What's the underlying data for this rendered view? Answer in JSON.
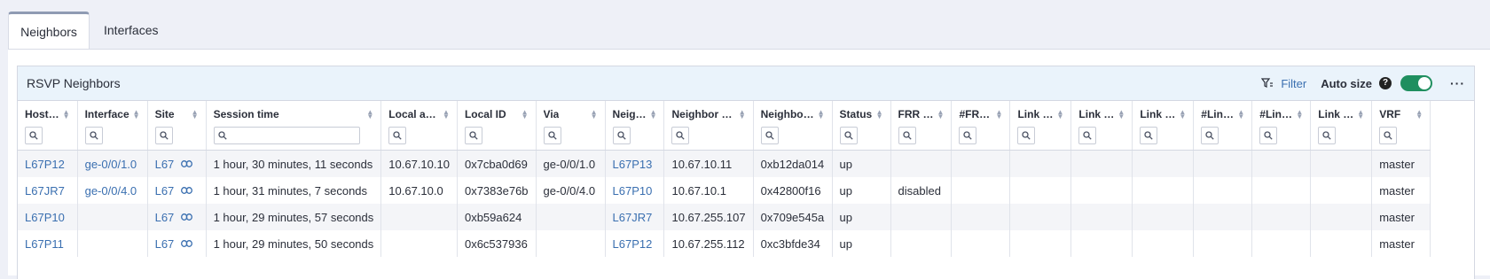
{
  "tabs": [
    {
      "label": "Neighbors",
      "active": true
    },
    {
      "label": "Interfaces",
      "active": false
    }
  ],
  "panel": {
    "title": "RSVP Neighbors",
    "filter_label": "Filter",
    "autosize_label": "Auto size",
    "help_glyph": "?",
    "autosize_on": true,
    "more_glyph": "···"
  },
  "columns": [
    {
      "key": "hostname",
      "label": "Host…"
    },
    {
      "key": "interface",
      "label": "Interface"
    },
    {
      "key": "site",
      "label": "Site"
    },
    {
      "key": "session_time",
      "label": "Session time"
    },
    {
      "key": "local_address",
      "label": "Local a…"
    },
    {
      "key": "local_id",
      "label": "Local ID"
    },
    {
      "key": "via",
      "label": "Via"
    },
    {
      "key": "neighbor_host",
      "label": "Neig…"
    },
    {
      "key": "neighbor_address",
      "label": "Neighbor …"
    },
    {
      "key": "neighbor_id",
      "label": "Neighbo…"
    },
    {
      "key": "status",
      "label": "Status"
    },
    {
      "key": "frr",
      "label": "FRR …"
    },
    {
      "key": "num_frr",
      "label": "#FR…"
    },
    {
      "key": "link1",
      "label": "Link …"
    },
    {
      "key": "link2",
      "label": "Link …"
    },
    {
      "key": "link3",
      "label": "Link …"
    },
    {
      "key": "num_link1",
      "label": "#Lin…"
    },
    {
      "key": "num_link2",
      "label": "#Lin…"
    },
    {
      "key": "link4",
      "label": "Link …"
    },
    {
      "key": "vrf",
      "label": "VRF"
    }
  ],
  "rows": [
    {
      "hostname": "L67P12",
      "interface": "ge-0/0/1.0",
      "site": "L67",
      "session_time": "1 hour, 30 minutes, 11 seconds",
      "local_address": "10.67.10.10",
      "local_id": "0x7cba0d69",
      "via": "ge-0/0/1.0",
      "neighbor_host": "L67P13",
      "neighbor_address": "10.67.10.11",
      "neighbor_id": "0xb12da014",
      "status": "up",
      "frr": "",
      "vrf": "master"
    },
    {
      "hostname": "L67JR7",
      "interface": "ge-0/0/4.0",
      "site": "L67",
      "session_time": "1 hour, 31 minutes, 7 seconds",
      "local_address": "10.67.10.0",
      "local_id": "0x7383e76b",
      "via": "ge-0/0/4.0",
      "neighbor_host": "L67P10",
      "neighbor_address": "10.67.10.1",
      "neighbor_id": "0x42800f16",
      "status": "up",
      "frr": "disabled",
      "vrf": "master"
    },
    {
      "hostname": "L67P10",
      "interface": "",
      "site": "L67",
      "session_time": "1 hour, 29 minutes, 57 seconds",
      "local_address": "",
      "local_id": "0xb59a624",
      "via": "",
      "neighbor_host": "L67JR7",
      "neighbor_address": "10.67.255.107",
      "neighbor_id": "0x709e545a",
      "status": "up",
      "frr": "",
      "vrf": "master"
    },
    {
      "hostname": "L67P11",
      "interface": "",
      "site": "L67",
      "session_time": "1 hour, 29 minutes, 50 seconds",
      "local_address": "",
      "local_id": "0x6c537936",
      "via": "",
      "neighbor_host": "L67P12",
      "neighbor_address": "10.67.255.112",
      "neighbor_id": "0xc3bfde34",
      "status": "up",
      "frr": "",
      "vrf": "master"
    }
  ],
  "colors": {
    "link": "#3a6fb0",
    "toggle_on": "#1f8f5f",
    "header_bg": "#eaf3fb"
  }
}
